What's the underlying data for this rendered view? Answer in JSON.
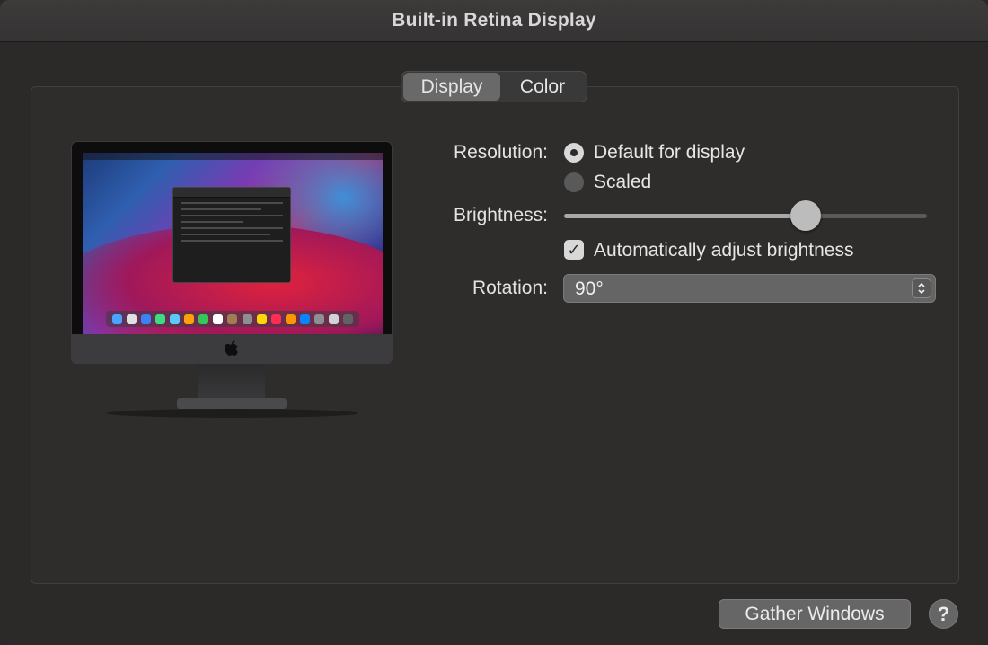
{
  "window": {
    "title": "Built-in Retina Display"
  },
  "tabs": [
    {
      "label": "Display",
      "selected": true
    },
    {
      "label": "Color",
      "selected": false
    }
  ],
  "resolution": {
    "label": "Resolution:",
    "options": [
      {
        "label": "Default for display",
        "selected": true
      },
      {
        "label": "Scaled",
        "selected": false
      }
    ]
  },
  "brightness": {
    "label": "Brightness:",
    "value": 0.68,
    "auto_label": "Automatically adjust brightness",
    "auto_checked": true
  },
  "rotation": {
    "label": "Rotation:",
    "value": "90°"
  },
  "footer": {
    "gather_label": "Gather Windows",
    "help_label": "?"
  },
  "icons": [
    "apple-logo-icon",
    "checkmark-icon",
    "updown-chevron-icon",
    "help-icon"
  ]
}
